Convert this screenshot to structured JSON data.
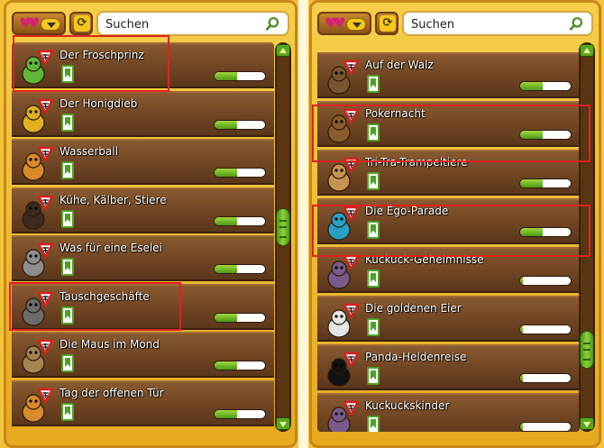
{
  "colors": {
    "panel_gold": "#f2c43a",
    "row_wood": "#6f4423",
    "progress_green": "#6bbf24",
    "highlight_red": "#e0221f"
  },
  "left_panel": {
    "search": {
      "placeholder": "Suchen",
      "icon": "search-icon"
    },
    "items": [
      {
        "title": "Der Froschprinz",
        "icon": "frog-icon",
        "progress": 0.45
      },
      {
        "title": "Der Honigdieb",
        "icon": "bee-icon",
        "progress": 0.45
      },
      {
        "title": "Wasserball",
        "icon": "bird-icon",
        "progress": 0.45
      },
      {
        "title": "Kühe, Kälber, Stiere",
        "icon": "cow-icon",
        "progress": 0.45
      },
      {
        "title": "Was für eine Eselei",
        "icon": "donkey-icon",
        "progress": 0.45
      },
      {
        "title": "Tauschgeschäfte",
        "icon": "raccoon-icon",
        "progress": 0.45
      },
      {
        "title": "Die Maus im Mond",
        "icon": "mouse-icon",
        "progress": 0.45
      },
      {
        "title": "Tag der offenen Tür",
        "icon": "bird-icon",
        "progress": 0.45
      }
    ]
  },
  "right_panel": {
    "search": {
      "placeholder": "Suchen",
      "icon": "search-icon"
    },
    "items": [
      {
        "title": "Auf der Walz",
        "icon": "bear-icon",
        "progress": 0.45
      },
      {
        "title": "Pokernacht",
        "icon": "dog-icon",
        "progress": 0.45
      },
      {
        "title": "Tri-Tra-Trampeltiere",
        "icon": "camel-icon",
        "progress": 0.45
      },
      {
        "title": "Die Ego-Parade",
        "icon": "peacock-icon",
        "progress": 0.45
      },
      {
        "title": "Kuckuck-Geheimnisse",
        "icon": "cuckoo-icon",
        "progress": 0.05
      },
      {
        "title": "Die goldenen Eier",
        "icon": "goose-icon",
        "progress": 0.05
      },
      {
        "title": "Panda-Heldenreise",
        "icon": "panda-icon",
        "progress": 0.05
      },
      {
        "title": "Kuckuckskinder",
        "icon": "cuckoo-icon",
        "progress": 0.05
      }
    ]
  }
}
